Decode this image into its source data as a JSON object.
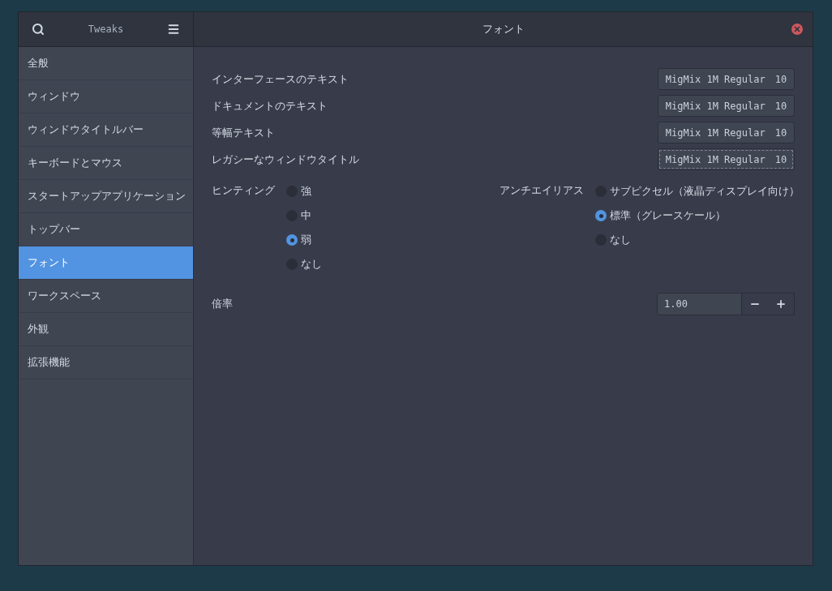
{
  "header": {
    "app_title": "Tweaks",
    "page_title": "フォント"
  },
  "sidebar": {
    "items": [
      {
        "label": "全般",
        "selected": false
      },
      {
        "label": "ウィンドウ",
        "selected": false
      },
      {
        "label": "ウィンドウタイトルバー",
        "selected": false
      },
      {
        "label": "キーボードとマウス",
        "selected": false
      },
      {
        "label": "スタートアップアプリケーション",
        "selected": false
      },
      {
        "label": "トップバー",
        "selected": false
      },
      {
        "label": "フォント",
        "selected": true
      },
      {
        "label": "ワークスペース",
        "selected": false
      },
      {
        "label": "外観",
        "selected": false
      },
      {
        "label": "拡張機能",
        "selected": false
      }
    ]
  },
  "fonts": [
    {
      "label": "インターフェースのテキスト",
      "font": "MigMix 1M Regular",
      "size": "10",
      "focused": false
    },
    {
      "label": "ドキュメントのテキスト",
      "font": "MigMix 1M Regular",
      "size": "10",
      "focused": false
    },
    {
      "label": "等幅テキスト",
      "font": "MigMix 1M Regular",
      "size": "10",
      "focused": false
    },
    {
      "label": "レガシーなウィンドウタイトル",
      "font": "MigMix 1M Regular",
      "size": "10",
      "focused": true
    }
  ],
  "hinting": {
    "label": "ヒンティング",
    "options": [
      {
        "label": "強",
        "selected": false
      },
      {
        "label": "中",
        "selected": false
      },
      {
        "label": "弱",
        "selected": true
      },
      {
        "label": "なし",
        "selected": false
      }
    ]
  },
  "antialiasing": {
    "label": "アンチエイリアス",
    "options": [
      {
        "label": "サブピクセル（液晶ディスプレイ向け）",
        "selected": false
      },
      {
        "label": "標準（グレースケール）",
        "selected": true
      },
      {
        "label": "なし",
        "selected": false
      }
    ]
  },
  "scaling": {
    "label": "倍率",
    "value": "1.00"
  }
}
